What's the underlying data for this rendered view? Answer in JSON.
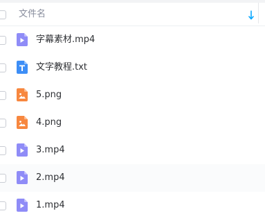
{
  "header": {
    "column_label": "文件名",
    "sort_icon": "sort-down-arrow-icon",
    "sort_color": "#06a7ff"
  },
  "files": [
    {
      "name": "字幕素材.mp4",
      "type": "video",
      "icon": "video-file-icon"
    },
    {
      "name": "文字教程.txt",
      "type": "text",
      "icon": "text-file-icon"
    },
    {
      "name": "5.png",
      "type": "image",
      "icon": "image-file-icon"
    },
    {
      "name": "4.png",
      "type": "image",
      "icon": "image-file-icon"
    },
    {
      "name": "3.mp4",
      "type": "video",
      "icon": "video-file-icon"
    },
    {
      "name": "2.mp4",
      "type": "video",
      "icon": "video-file-icon"
    },
    {
      "name": "1.mp4",
      "type": "video",
      "icon": "video-file-icon"
    }
  ],
  "colors": {
    "video": "#8f8cf7",
    "text": "#3d8ef6",
    "image": "#f7873f"
  }
}
